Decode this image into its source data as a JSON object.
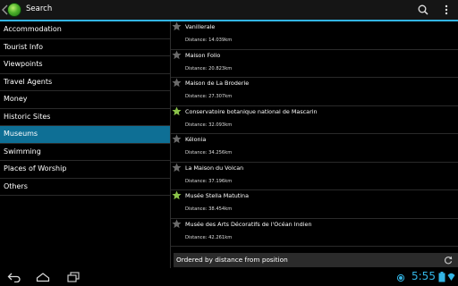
{
  "actionbar": {
    "title": "Search",
    "logo_icon": "globe-logo-icon",
    "search_icon": "search-icon",
    "overflow_icon": "overflow-menu-icon"
  },
  "categories": [
    {
      "label": "Accommodation",
      "active": false
    },
    {
      "label": "Tourist Info",
      "active": false
    },
    {
      "label": "Viewpoints",
      "active": false
    },
    {
      "label": "Travel Agents",
      "active": false
    },
    {
      "label": "Money",
      "active": false
    },
    {
      "label": "Historic Sites",
      "active": false
    },
    {
      "label": "Museums",
      "active": true
    },
    {
      "label": "Swimming",
      "active": false
    },
    {
      "label": "Places of Worship",
      "active": false
    },
    {
      "label": "Others",
      "active": false
    }
  ],
  "results": [
    {
      "name": "Vanillerale",
      "distance": "Distance: 14.039km",
      "favorite": false
    },
    {
      "name": "Maison Folio",
      "distance": "Distance: 20.823km",
      "favorite": false
    },
    {
      "name": "Maison de La Broderie",
      "distance": "Distance: 27.307km",
      "favorite": false
    },
    {
      "name": "Conservatoire botanique national de Mascarin",
      "distance": "Distance: 32.093km",
      "favorite": true
    },
    {
      "name": "Kélonia",
      "distance": "Distance: 34.256km",
      "favorite": false
    },
    {
      "name": "La Maison du Volcan",
      "distance": "Distance: 37.196km",
      "favorite": false
    },
    {
      "name": "Musée Stella Matutina",
      "distance": "Distance: 38.454km",
      "favorite": true
    },
    {
      "name": "Musée des Arts Décoratifs de l'Océan Indien",
      "distance": "Distance: 42.261km",
      "favorite": false
    }
  ],
  "sortbar": {
    "label": "Ordered by distance from position",
    "refresh_icon": "refresh-icon"
  },
  "status": {
    "time": "5:55"
  },
  "colors": {
    "accent": "#33b5e5",
    "active_category": "#0e6f95",
    "star_favorite": "#8bc34a",
    "star_default": "#6a6a6a"
  }
}
